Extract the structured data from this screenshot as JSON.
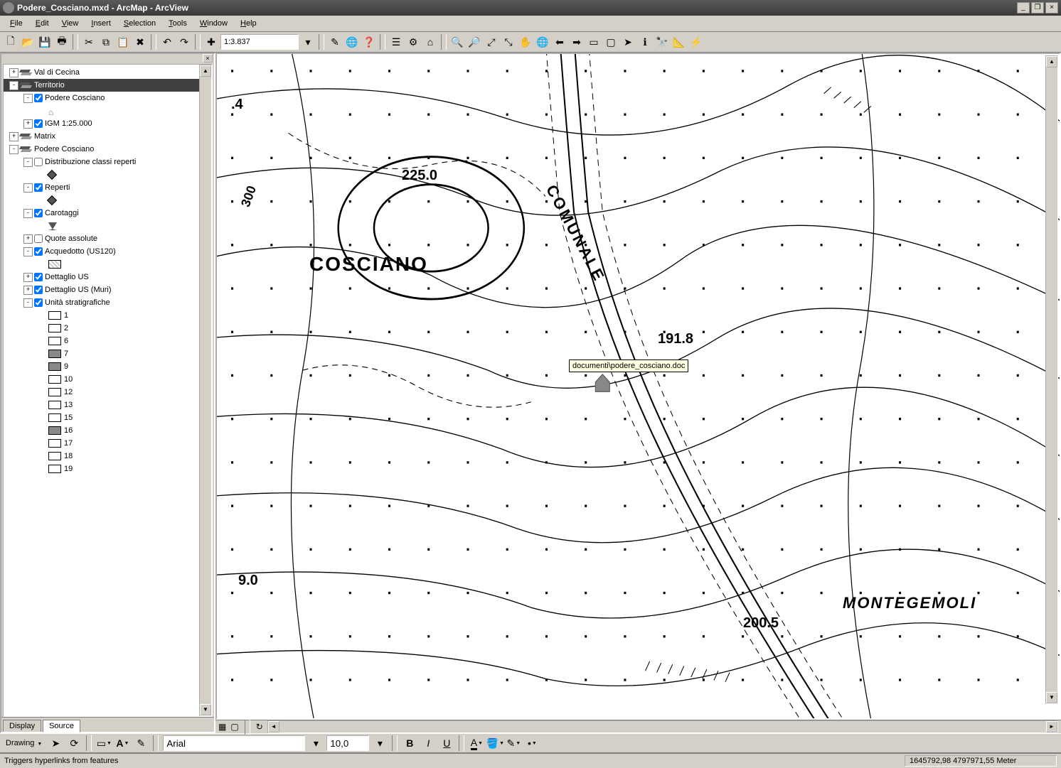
{
  "title": "Podere_Cosciano.mxd - ArcMap - ArcView",
  "menu": [
    "File",
    "Edit",
    "View",
    "Insert",
    "Selection",
    "Tools",
    "Window",
    "Help"
  ],
  "scale": "1:3.837",
  "toc": {
    "tabs": [
      "Display",
      "Source"
    ],
    "active_tab": "Source",
    "items": [
      {
        "depth": 0,
        "exp": "+",
        "icon": "layers",
        "label": "Val di Cecina"
      },
      {
        "depth": 0,
        "exp": "-",
        "icon": "layers",
        "label": "Territorio",
        "selected": true
      },
      {
        "depth": 1,
        "exp": "-",
        "check": true,
        "label": "Podere Cosciano"
      },
      {
        "depth": 2,
        "sym": "home",
        "label": ""
      },
      {
        "depth": 1,
        "exp": "+",
        "check": true,
        "label": "IGM 1:25.000"
      },
      {
        "depth": 0,
        "exp": "+",
        "icon": "layers",
        "label": "Matrix"
      },
      {
        "depth": 0,
        "exp": "-",
        "icon": "layers",
        "label": "Podere Cosciano"
      },
      {
        "depth": 1,
        "exp": "-",
        "check": false,
        "label": "Distribuzione classi reperti"
      },
      {
        "depth": 2,
        "sym": "diamond",
        "label": ""
      },
      {
        "depth": 1,
        "exp": "-",
        "check": true,
        "label": "Reperti"
      },
      {
        "depth": 2,
        "sym": "diamond",
        "label": ""
      },
      {
        "depth": 1,
        "exp": "-",
        "check": true,
        "label": "Carotaggi"
      },
      {
        "depth": 2,
        "sym": "tri",
        "label": ""
      },
      {
        "depth": 1,
        "exp": "+",
        "check": false,
        "label": "Quote assolute"
      },
      {
        "depth": 1,
        "exp": "-",
        "check": true,
        "label": "Acquedotto (US120)"
      },
      {
        "depth": 2,
        "sym": "hatch",
        "label": ""
      },
      {
        "depth": 1,
        "exp": "+",
        "check": true,
        "label": "Dettaglio US"
      },
      {
        "depth": 1,
        "exp": "+",
        "check": true,
        "label": "Dettaglio US (Muri)"
      },
      {
        "depth": 1,
        "exp": "-",
        "check": true,
        "label": "Unità stratigrafiche"
      },
      {
        "depth": 2,
        "sym": "box",
        "label": "1"
      },
      {
        "depth": 2,
        "sym": "box",
        "label": "2"
      },
      {
        "depth": 2,
        "sym": "box",
        "label": "6"
      },
      {
        "depth": 2,
        "sym": "dark",
        "label": "7"
      },
      {
        "depth": 2,
        "sym": "dark",
        "label": "9"
      },
      {
        "depth": 2,
        "sym": "box",
        "label": "10"
      },
      {
        "depth": 2,
        "sym": "box",
        "label": "12"
      },
      {
        "depth": 2,
        "sym": "box",
        "label": "13"
      },
      {
        "depth": 2,
        "sym": "box",
        "label": "15"
      },
      {
        "depth": 2,
        "sym": "dark",
        "label": "16"
      },
      {
        "depth": 2,
        "sym": "box",
        "label": "17"
      },
      {
        "depth": 2,
        "sym": "box",
        "label": "18"
      },
      {
        "depth": 2,
        "sym": "box",
        "label": "19"
      }
    ]
  },
  "map_labels": {
    "cosciano": "COSCIANO",
    "comunale": "COMUNALE",
    "montegemoli": "MONTEGEMOLI",
    "elev_225": "225.0",
    "elev_191": "191.8",
    "elev_200": "200.5",
    "elev_90": "9.0",
    "elev_4": ".4",
    "elev_300": "300"
  },
  "tooltip": "documenti\\podere_cosciano.doc",
  "drawing": {
    "label": "Drawing",
    "font": "Arial",
    "size": "10,0"
  },
  "status": {
    "msg": "Triggers hyperlinks from features",
    "coords": "1645792,98 4797971,55 Meter"
  }
}
